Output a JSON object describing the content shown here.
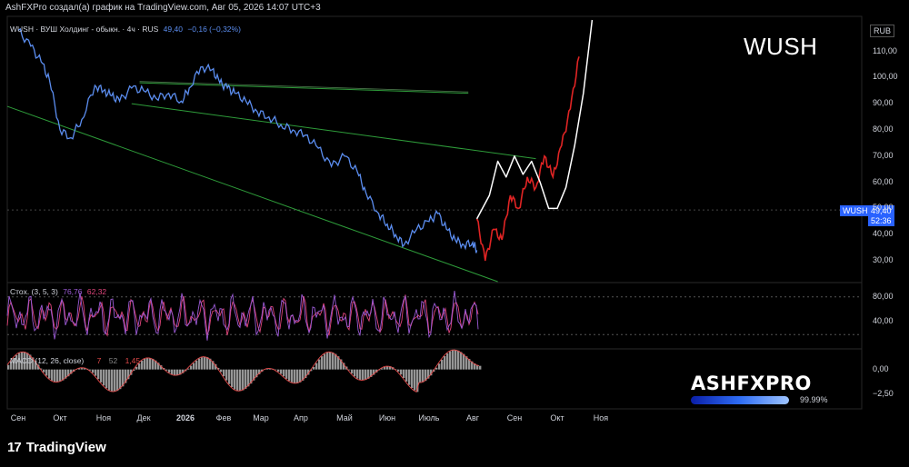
{
  "header": {
    "text": "AshFXPro создал(а) график на TradingView.com, Авг 05, 2026 14:07 UTC+3"
  },
  "legend": {
    "main": "WUSH · ВУШ Холдинг - обыкн. · 4ч · RUS",
    "last": "49,40",
    "change": "−0,16 (−0,32%)",
    "stoch_label": "Стох. (3, 5, 3)",
    "stoch_k": "76,76",
    "stoch_d": "62,32",
    "macd_label": "MACD (12, 26, close)",
    "macd_v1": "7",
    "macd_v2": "52",
    "macd_v3": "1,45"
  },
  "watermark": "WUSH",
  "currency": "RUB",
  "price_tag": {
    "symbol": "WUSH",
    "price": "49,40",
    "countdown": "52:36"
  },
  "brand": {
    "name": "ASHFXPRO",
    "progress": 0.9999,
    "progress_label": "99.99%"
  },
  "footer": {
    "logo": "TradingView"
  },
  "colors": {
    "price": "#5b8def",
    "red_projection": "#e02424",
    "white_projection": "#ffffff",
    "trendline": "#2e9c3a",
    "stoch_k": "#9b5bd6",
    "stoch_d": "#e0457b",
    "macd_hist": "#b0b0b0",
    "macd_line": "#e24a4a"
  },
  "chart_data": [
    {
      "type": "line",
      "name": "price",
      "yticks": [
        "30,00",
        "40,00",
        "50,00",
        "60,00",
        "70,00",
        "80,00",
        "90,00",
        "100,00",
        "110,00"
      ],
      "ylim": [
        22,
        122
      ],
      "xticks": [
        "Сен",
        "Окт",
        "Ноя",
        "Дек",
        "2026",
        "Фев",
        "Мар",
        "Апр",
        "Май",
        "Июн",
        "Июль",
        "Авг",
        "Сен",
        "Окт",
        "Ноя"
      ],
      "series": [
        {
          "kind": "price",
          "x": [
            0,
            0.3,
            0.55,
            0.75,
            1.0,
            1.25,
            1.5,
            1.8,
            2.0,
            2.2,
            2.4,
            2.7,
            3.0,
            3.3,
            3.6,
            3.9,
            4.1,
            4.4,
            4.7,
            4.9,
            5.1,
            5.3,
            5.6,
            5.9,
            6.2,
            6.5,
            6.8,
            7.1,
            7.4,
            7.7,
            8.0,
            8.3,
            8.5,
            8.8,
            9.0,
            9.2,
            9.4,
            9.7,
            10.0,
            10.2,
            10.4,
            10.6,
            10.8,
            11.0,
            11.1
          ],
          "y": [
            118,
            112,
            106,
            99,
            80,
            77,
            84,
            97,
            95,
            93,
            91,
            96,
            95,
            92,
            94,
            91,
            96,
            104,
            103,
            98,
            96,
            94,
            91,
            87,
            85,
            82,
            80,
            78,
            73,
            66,
            70,
            64,
            56,
            48,
            44,
            40,
            36,
            42,
            45,
            48,
            42,
            38,
            36,
            37,
            34
          ]
        },
        {
          "kind": "white_projection",
          "x": [
            11.1,
            11.4,
            11.6,
            11.8,
            12.0,
            12.2,
            12.4,
            12.6,
            12.8,
            13.0,
            13.2,
            13.4,
            13.6,
            13.8
          ],
          "y": [
            46,
            55,
            68,
            62,
            70,
            63,
            68,
            60,
            50,
            50,
            58,
            74,
            94,
            122
          ]
        },
        {
          "kind": "red_projection",
          "x": [
            11.1,
            11.3,
            11.5,
            11.7,
            11.9,
            12.1,
            12.3,
            12.5,
            12.7,
            12.9,
            13.1,
            13.3,
            13.5
          ],
          "y": [
            46,
            30,
            42,
            38,
            55,
            50,
            62,
            58,
            70,
            62,
            74,
            88,
            108
          ]
        }
      ]
    },
    {
      "type": "line",
      "name": "stochastic",
      "yticks": [
        "40,00",
        "80,00"
      ],
      "ylim": [
        0,
        100
      ],
      "series": [
        {
          "kind": "stoch_k"
        },
        {
          "kind": "stoch_d"
        }
      ]
    },
    {
      "type": "bar",
      "name": "macd",
      "yticks": [
        "0,00",
        "−2,50"
      ],
      "ylim": [
        -4,
        2
      ]
    }
  ]
}
